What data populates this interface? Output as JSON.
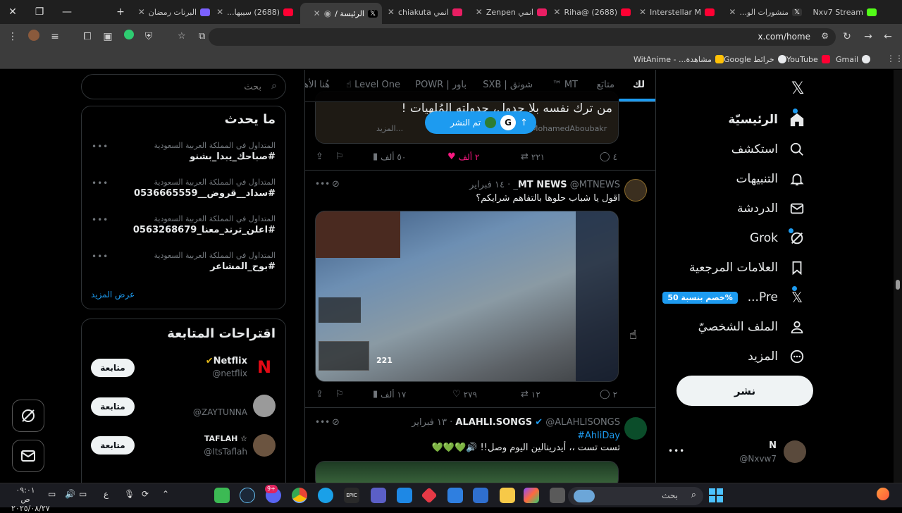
{
  "browser": {
    "tabs": [
      {
        "title": "Nxv7 Stream",
        "fav_color": "#53fc18"
      },
      {
        "title": "منشورات الو...",
        "fav_color": "#e7e9ea"
      },
      {
        "title": "Interstellar M",
        "fav_color": "#ff0033"
      },
      {
        "title": "(2688) @Riha",
        "fav_color": "#ff0033"
      },
      {
        "title": "انمي Zenpen",
        "fav_color": "#e91e63"
      },
      {
        "title": "انمي chiakuta",
        "fav_color": "#e91e63"
      },
      {
        "title": "الرئيسة /",
        "fav_color": "#e7e9ea"
      },
      {
        "title": "(2688) سيبها...",
        "fav_color": "#ff0033"
      },
      {
        "title": "البرنات رمضان",
        "fav_color": "#7b61ff"
      }
    ],
    "url": "x.com/home",
    "bookmarks": [
      {
        "label": "Gmail",
        "color": "#e8eaed"
      },
      {
        "label": "YouTube",
        "color": "#ff0033"
      },
      {
        "label": "خرائط Google",
        "color": "#e8eaed"
      },
      {
        "label": "مشاهدة... - WitAnime",
        "color": "#ffc107"
      }
    ]
  },
  "nav": {
    "items": [
      {
        "label": "الرئيسيّة",
        "icon": "home-icon"
      },
      {
        "label": "استكشف",
        "icon": "search-icon"
      },
      {
        "label": "التنبيهات",
        "icon": "bell-icon"
      },
      {
        "label": "الدردشة",
        "icon": "mail-icon"
      },
      {
        "label": "Grok",
        "icon": "grok-icon"
      },
      {
        "label": "العلامات المرجعية",
        "icon": "bookmark-icon"
      },
      {
        "label": "Pre...",
        "icon": "x-premium-icon"
      },
      {
        "label": "الملف الشخصيّ",
        "icon": "profile-icon"
      },
      {
        "label": "المزيد",
        "icon": "more-icon"
      }
    ],
    "premium_badge": "%خصم بنسبة 50",
    "post_button": "نشر",
    "account": {
      "name": "N",
      "handle": "@Nxvw7"
    }
  },
  "timeline": {
    "tabs": [
      "لك",
      "متابَع",
      "MT ™",
      "شونق | SXB",
      "باور | POWR",
      "Level One ☝",
      "هُنا الأهـ"
    ],
    "posted_pill": "تم النشر",
    "partial_tweet": {
      "text": "من ترك نفسه بلا جدول، جدولته المُلهيات !",
      "author": "MohamedAboubakr",
      "more": "...المزيد",
      "replies": "٤",
      "retweets": "٢٢١",
      "likes": "٢ ألف",
      "views": "٥٠ ألف"
    },
    "tweets": [
      {
        "name": "MT NEWS",
        "handle": "@MTNEWS_",
        "time": "١٤ فبراير",
        "text": "اقول يا شباب حلوها بالتفاهم شرايكم؟",
        "media_overlay": "221",
        "replies": "٢",
        "retweets": "١٢",
        "likes": "٢٧٩",
        "views": "١٧ ألف"
      },
      {
        "name": "ALAHLI.SONGS",
        "handle": "@ALAHLISONGS",
        "time": "١٣ فبراير",
        "hashtag": "#AhliDay",
        "text": "تست تست ،، أيدرينالين اليوم وصل!! 🔊💚💚💚"
      }
    ]
  },
  "sidebar": {
    "search_placeholder": "بحث",
    "trends_title": "ما يحدث",
    "trends": [
      {
        "context": "المتداول في المملكة العربية السعودية",
        "name": "#صباحك_يبدا_بشنو"
      },
      {
        "context": "المتداول في المملكة العربية السعودية",
        "name": "#سداد__قروض__0536665559"
      },
      {
        "context": "المتداول في المملكة العربية السعودية",
        "name": "#اعلن_ترند_معنا_0563268679"
      },
      {
        "context": "المتداول في المملكة العربية السعودية",
        "name": "#بوح_المشاعر"
      }
    ],
    "show_more": "عرض المزيد",
    "suggestions_title": "اقتراحات المتابعة",
    "suggestions": [
      {
        "name": "Netflix",
        "handle": "@netflix",
        "follow": "متابعة"
      },
      {
        "name": "",
        "handle": "@ZAYTUNNA",
        "follow": "متابعة"
      },
      {
        "name": "TAFLAH ☆",
        "handle": "@ItsTaflah",
        "follow": "متابعة"
      }
    ]
  },
  "taskbar": {
    "search_placeholder": "بحث",
    "time": "٠٩:٠١ ص",
    "date": "٢٠٢٥/٠٨/٢٧",
    "lang": "ع",
    "notif_badge": "9+"
  }
}
